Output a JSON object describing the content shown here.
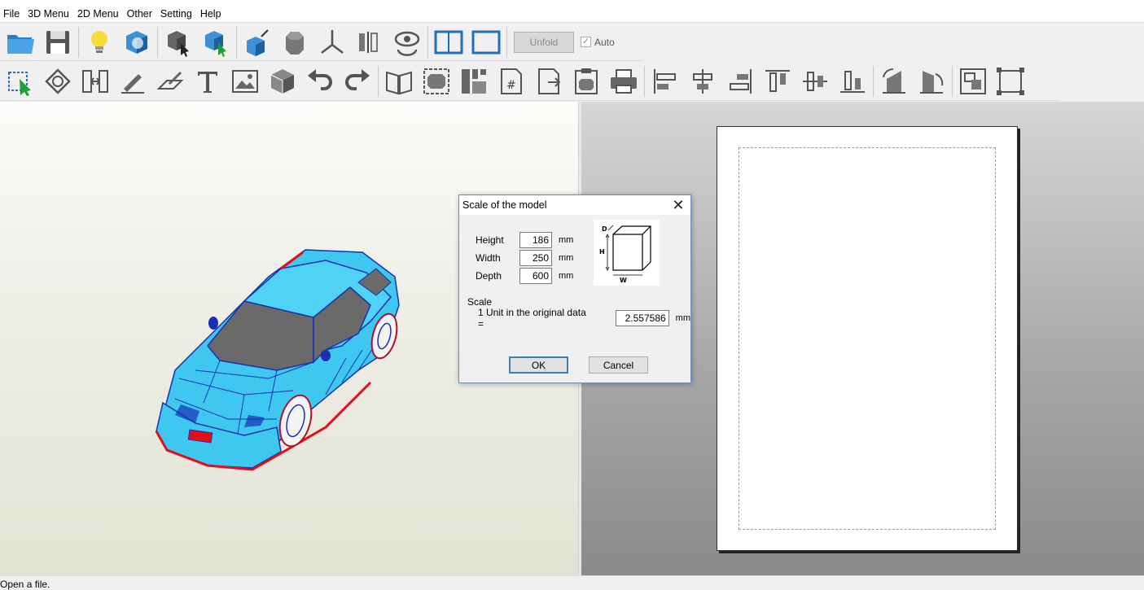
{
  "menubar": {
    "items": [
      "File",
      "3D Menu",
      "2D Menu",
      "Other",
      "Setting",
      "Help"
    ]
  },
  "toolbar1": {
    "unfold_label": "Unfold",
    "auto_label": "Auto",
    "auto_checked": true,
    "icons": [
      "open-folder-icon",
      "save-icon",
      "light-bulb-icon",
      "texture-cube-icon",
      "select-face-icon",
      "select-part-icon",
      "cube-edge-icon",
      "cylinder-icon",
      "axis-icon",
      "mirror-icon",
      "view-eye-icon",
      "split-view-icon",
      "single-view-icon"
    ]
  },
  "toolbar2": {
    "icons": [
      "move-select-icon",
      "rotate-icon",
      "join-icon",
      "edit-line-icon",
      "fold-line-icon",
      "text-icon",
      "image-icon",
      "box-icon",
      "undo-icon",
      "redo-icon",
      "book-icon",
      "fit-icon",
      "layout-icon",
      "page-number-icon",
      "export-icon",
      "clipboard-icon",
      "print-icon",
      "align-left-icon",
      "align-center-icon",
      "align-right-icon",
      "align-top-icon",
      "align-middle-icon",
      "align-bottom-icon",
      "rotate-left-icon",
      "rotate-right-icon",
      "group-icon",
      "ungroup-icon"
    ]
  },
  "dialog": {
    "title": "Scale of the model",
    "height_label": "Height",
    "height_value": "186",
    "width_label": "Width",
    "width_value": "250",
    "depth_label": "Depth",
    "depth_value": "600",
    "unit": "mm",
    "diagram_d": "D",
    "diagram_h": "H",
    "diagram_w": "W",
    "scale_label": "Scale",
    "scale_text": "1 Unit in the original data =",
    "scale_value": "2.557586",
    "ok_label": "OK",
    "cancel_label": "Cancel"
  },
  "status": {
    "text": "Open a file."
  },
  "colors": {
    "model_body": "#3ec8f0",
    "model_wire": "#1a2fb0",
    "model_trim": "#e0101a",
    "model_glass": "#6a6a6a"
  }
}
